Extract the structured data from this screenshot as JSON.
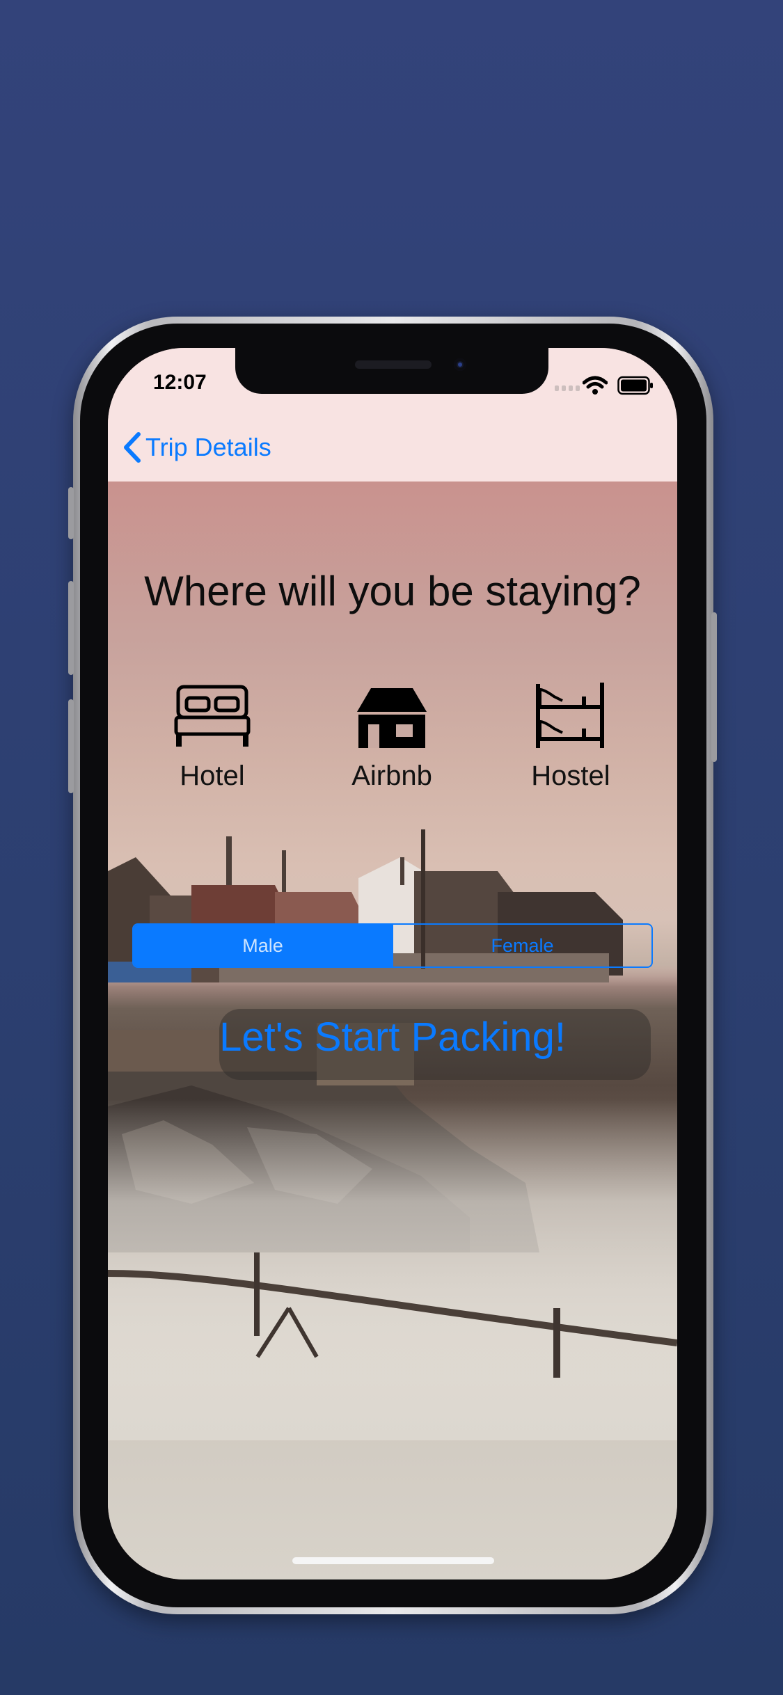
{
  "status_bar": {
    "time": "12:07"
  },
  "nav": {
    "back_label": "Trip Details"
  },
  "main": {
    "question": "Where will you be staying?",
    "options": [
      {
        "label": "Hotel",
        "icon": "bed-icon"
      },
      {
        "label": "Airbnb",
        "icon": "house-icon"
      },
      {
        "label": "Hostel",
        "icon": "bunk-bed-icon"
      }
    ],
    "gender_segment": {
      "options": [
        "Male",
        "Female"
      ],
      "selected": "Male"
    },
    "cta_label": "Let's Start Packing!"
  },
  "colors": {
    "accent": "#0a7aff",
    "page_background": "#2e3f72",
    "navbar": "#f8e3e2"
  }
}
